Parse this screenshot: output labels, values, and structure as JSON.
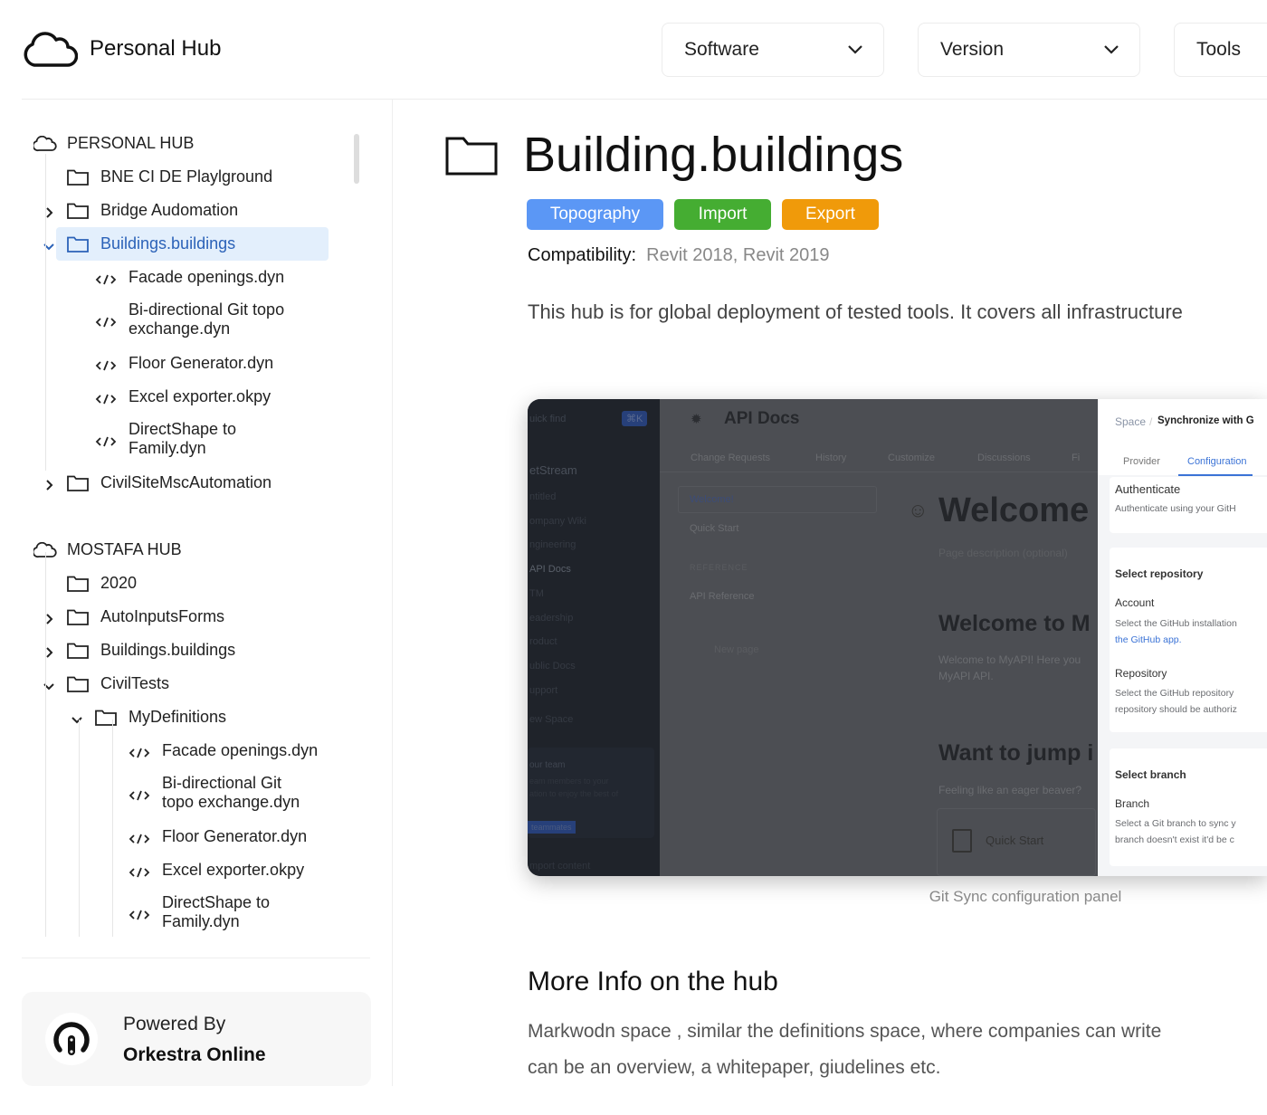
{
  "header": {
    "brand": "Personal Hub",
    "dropdowns": [
      {
        "label": "Software"
      },
      {
        "label": "Version"
      },
      {
        "label": "Tools"
      }
    ]
  },
  "sidebar": {
    "tree": [
      {
        "kind": "hub",
        "label": "PERSONAL HUB",
        "level": 0
      },
      {
        "kind": "folder",
        "label": "BNE CI DE Playlground",
        "level": 1
      },
      {
        "kind": "folder",
        "label": "Bridge Audomation",
        "level": 1,
        "expandable": true,
        "expanded": false
      },
      {
        "kind": "folder",
        "label": "Buildings.buildings",
        "level": 1,
        "expandable": true,
        "expanded": true,
        "selected": true
      },
      {
        "kind": "file",
        "label": "Facade openings.dyn",
        "level": 2
      },
      {
        "kind": "file",
        "label": "Bi-directional Git topo",
        "label2": "exchange.dyn",
        "level": 2
      },
      {
        "kind": "file",
        "label": "Floor Generator.dyn",
        "level": 2
      },
      {
        "kind": "file",
        "label": "Excel exporter.okpy",
        "level": 2
      },
      {
        "kind": "file",
        "label": "DirectShape to",
        "label2": "Family.dyn",
        "level": 2
      },
      {
        "kind": "folder",
        "label": "CivilSiteMscAutomation",
        "level": 1,
        "expandable": true,
        "expanded": false
      },
      {
        "kind": "hub",
        "label": "MOSTAFA HUB",
        "level": 0
      },
      {
        "kind": "folder",
        "label": "2020",
        "level": 1
      },
      {
        "kind": "folder",
        "label": "AutoInputsForms",
        "level": 1,
        "expandable": true,
        "expanded": false
      },
      {
        "kind": "folder",
        "label": "Buildings.buildings",
        "level": 1,
        "expandable": true,
        "expanded": false
      },
      {
        "kind": "folder",
        "label": "CivilTests",
        "level": 1,
        "expandable": true,
        "expanded": true
      },
      {
        "kind": "folder",
        "label": "MyDefinitions",
        "level": 2,
        "expandable": true,
        "expanded": true
      },
      {
        "kind": "file",
        "label": "Facade openings.dyn",
        "level": 3
      },
      {
        "kind": "file",
        "label": "Bi-directional Git",
        "label2": "topo exchange.dyn",
        "level": 3
      },
      {
        "kind": "file",
        "label": "Floor Generator.dyn",
        "level": 3
      },
      {
        "kind": "file",
        "label": "Excel exporter.okpy",
        "level": 3
      },
      {
        "kind": "file",
        "label": "DirectShape to",
        "label2": "Family.dyn",
        "level": 3
      },
      {
        "kind": "folder",
        "label": "MyDefinitions",
        "level": 2
      }
    ],
    "powered_by": "Powered By",
    "powered_name": "Orkestra Online"
  },
  "main": {
    "title": "Building.buildings",
    "tags": [
      {
        "label": "Topography",
        "color": "#5b97f5"
      },
      {
        "label": "Import",
        "color": "#45ad32"
      },
      {
        "label": "Export",
        "color": "#f09a0a"
      }
    ],
    "compat_label": "Compatibility:",
    "compat_value": "Revit 2018, Revit 2019",
    "description": "This hub is for global deployment of tested tools. It covers all infrastructure",
    "image_caption": "Git Sync configuration panel",
    "section_title": "More Info on the hub",
    "section_lines": [
      "Markwodn space , similar the definitions space, where companies can write",
      "can be an overview, a whitepaper, giudelines etc."
    ]
  },
  "screenshot": {
    "quick_find": "uick find",
    "shortcut": "⌘K",
    "space": "etStream",
    "nav": [
      "ntitled",
      "ompany Wiki",
      "ngineering",
      "API Docs",
      "TM",
      "eadership",
      "roduct",
      "ublic Docs",
      "upport",
      "ew Space"
    ],
    "team_title": "our team",
    "team_text1": "eam members to your",
    "team_text2": "ation to enjoy the best of",
    "team_button": "teammates",
    "import": "mport content",
    "page_title": "API Docs",
    "tabs": [
      "Change Requests",
      "History",
      "Customize",
      "Discussions",
      "Fi"
    ],
    "toc": {
      "welcome": "Welcome!",
      "quick_start": "Quick Start",
      "reference": "REFERENCE",
      "api_ref": "API Reference",
      "new_page": "New page"
    },
    "welcome": "Welcome",
    "page_desc": "Page description (optional)",
    "h_welcome": "Welcome to M",
    "p_welcome1": "Welcome to MyAPI! Here you",
    "p_welcome2": "MyAPI API.",
    "h_jump": "Want to jump i",
    "p_jump": "Feeling like an eager beaver?",
    "card_quick": "Quick Start",
    "panel": {
      "crumb1": "Space",
      "crumb_sep": "/",
      "crumb2": "Synchronize with G",
      "tab1": "Provider",
      "tab2": "Configuration",
      "auth_title": "Authenticate",
      "auth_text": "Authenticate using your GitH",
      "repo_section": "Select repository",
      "account": "Account",
      "account_text": "Select the GitHub installation",
      "account_link": "the GitHub app.",
      "repository": "Repository",
      "repo_text1": "Select the GitHub repository",
      "repo_text2": "repository should be authoriz",
      "branch_section": "Select branch",
      "branch": "Branch",
      "branch_text1": "Select a Git branch to sync y",
      "branch_text2": "branch doesn't exist it'd be c"
    }
  }
}
